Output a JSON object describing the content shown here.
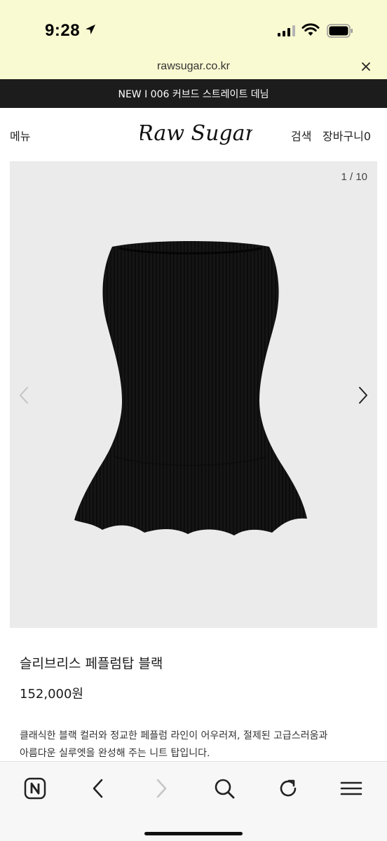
{
  "status_bar": {
    "time": "9:28"
  },
  "browser": {
    "url": "rawsugar.co.kr"
  },
  "announcement": {
    "text": "NEW I 006 커브드 스트레이트 데님"
  },
  "header": {
    "menu_label": "메뉴",
    "logo_text": "Raw Sugar",
    "search_label": "검색",
    "cart_label": "장바구니0"
  },
  "product": {
    "slide_counter": "1 / 10",
    "name": "슬리브리스 페플럼탑 블랙",
    "price": "152,000원",
    "description_line1": "클래식한 블랙 컬러와 정교한 페플럼 라인이 어우러져, 절제된 고급스러움과",
    "description_line2": "아름다운 실루엣을 완성해 주는 니트 탑입니다.",
    "image_subject": "black sleeveless ribbed knit peplum top"
  },
  "toolbar": {
    "icons": [
      "naver-home-icon",
      "back-icon",
      "forward-icon",
      "search-icon",
      "reload-icon",
      "menu-icon"
    ]
  },
  "colors": {
    "browser_bar_bg": "#fafad2",
    "announcement_bg": "#1c1c1c",
    "image_bg": "#ebebeb",
    "garment": "#141414"
  }
}
